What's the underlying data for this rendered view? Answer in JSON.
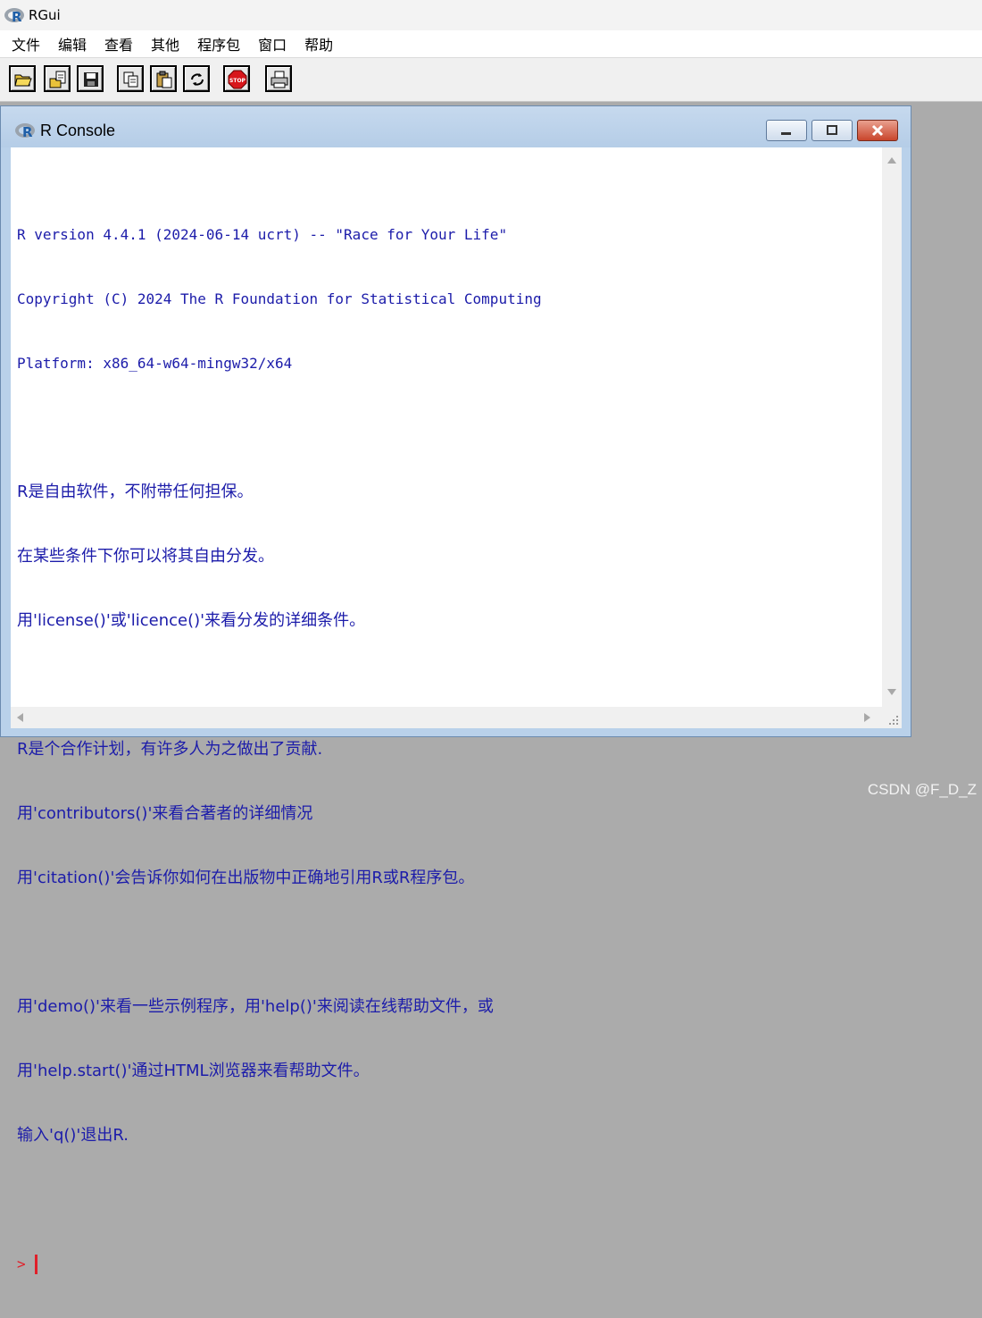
{
  "app": {
    "title": "RGui"
  },
  "menu": [
    "文件",
    "编辑",
    "查看",
    "其他",
    "程序包",
    "窗口",
    "帮助"
  ],
  "toolbar": {
    "buttons": [
      "open-script-icon",
      "load-workspace-icon",
      "save-workspace-icon",
      "copy-icon",
      "paste-icon",
      "refresh-icon",
      "stop-icon",
      "print-icon"
    ],
    "stop_label": "STOP"
  },
  "console": {
    "title": "R Console",
    "lines": [
      "R version 4.4.1 (2024-06-14 ucrt) -- \"Race for Your Life\"",
      "Copyright (C) 2024 The R Foundation for Statistical Computing",
      "Platform: x86_64-w64-mingw32/x64",
      "",
      "R是自由软件，不附带任何担保。",
      "在某些条件下你可以将其自由分发。",
      "用'license()'或'licence()'来看分发的详细条件。",
      "",
      "R是个合作计划，有许多人为之做出了贡献.",
      "用'contributors()'来看合著者的详细情况",
      "用'citation()'会告诉你如何在出版物中正确地引用R或R程序包。",
      "",
      "用'demo()'来看一些示例程序，用'help()'来阅读在线帮助文件，或",
      "用'help.start()'通过HTML浏览器来看帮助文件。",
      "输入'q()'退出R."
    ],
    "prompt": ">",
    "colors": {
      "text": "#1c1caa",
      "prompt": "#e0202a"
    }
  },
  "watermark": "CSDN @F_D_Z"
}
